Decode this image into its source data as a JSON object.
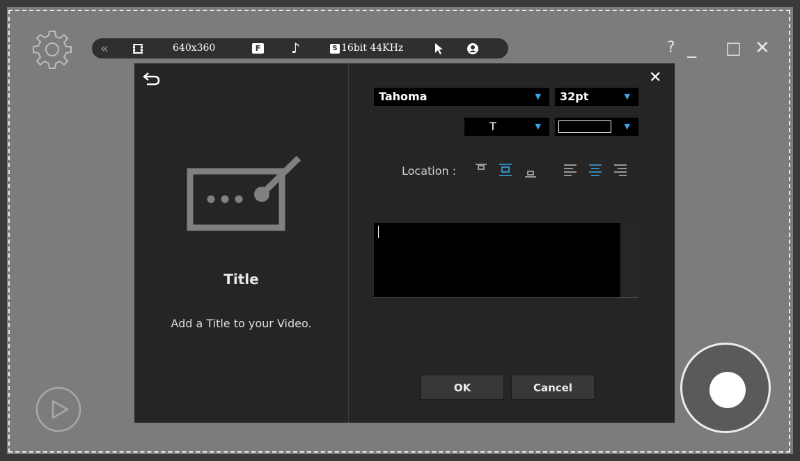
{
  "toolbar": {
    "collapse_icon": "double-chevron-left-icon",
    "film_icon": "film-icon",
    "resolution": "640x360",
    "fps_icon": "frame-rate-icon",
    "fps_letter": "F",
    "audio_icon": "music-note-icon",
    "sound_icon": "sound-badge-icon",
    "sound_letter": "S",
    "audio_quality": "16bit 44KHz",
    "cursor_icon": "pointer-icon",
    "webcam_icon": "webcam-icon"
  },
  "window": {
    "help": "?",
    "minimize": "_",
    "maximize": "□",
    "close": "✕"
  },
  "dialog": {
    "back_icon": "back-arrow-icon",
    "close": "✕",
    "title": "Title",
    "description": "Add a Title to your Video.",
    "font": "Tahoma",
    "font_size": "32pt",
    "text_style": "T",
    "color_swatch": "#000000",
    "location_label": "Location :",
    "location_options": [
      "top",
      "middle",
      "bottom"
    ],
    "location_selected": "middle",
    "align_options": [
      "left",
      "center",
      "right"
    ],
    "align_selected": "center",
    "text_value": "",
    "ok_label": "OK",
    "cancel_label": "Cancel"
  },
  "colors": {
    "accent": "#3aa7e6",
    "panel": "#252525",
    "backdrop": "#7c7c7c"
  }
}
